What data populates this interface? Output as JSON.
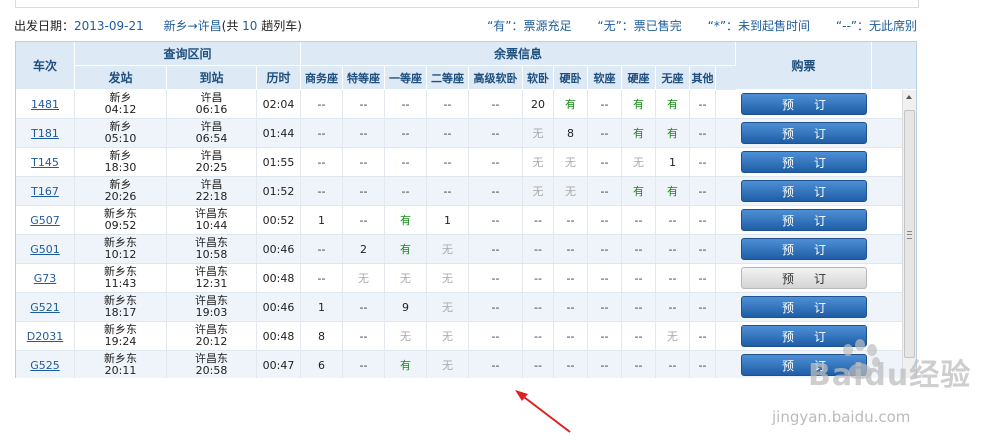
{
  "info": {
    "date_label": "出发日期：",
    "date": "2013-09-21",
    "route": "新乡→许昌",
    "count_prefix": "(共",
    "count": "10",
    "count_suffix": "趟列车)",
    "legend": [
      "“有”：票源充足",
      "“无”：票已售完",
      "“*”：未到起售时间",
      "“--”：无此席别"
    ]
  },
  "table": {
    "train_header": "车次",
    "range_header": "查询区间",
    "depart_header": "发站",
    "arrive_header": "到站",
    "duration_header": "历时",
    "ticket_header": "余票信息",
    "buy_header": "购票",
    "seat_headers": [
      "商务座",
      "特等座",
      "一等座",
      "二等座",
      "高级软卧",
      "软卧",
      "硬卧",
      "软座",
      "硬座",
      "无座",
      "其他"
    ],
    "book_label": "预订"
  },
  "rows": [
    {
      "train": "1481",
      "from": "新乡",
      "from_time": "04:12",
      "to": "许昌",
      "to_time": "06:16",
      "duration": "02:04",
      "seats": [
        "--",
        "--",
        "--",
        "--",
        "--",
        "20",
        "有",
        "--",
        "有",
        "有",
        "--"
      ],
      "enabled": true
    },
    {
      "train": "T181",
      "from": "新乡",
      "from_time": "05:10",
      "to": "许昌",
      "to_time": "06:54",
      "duration": "01:44",
      "seats": [
        "--",
        "--",
        "--",
        "--",
        "--",
        "无",
        "8",
        "--",
        "有",
        "有",
        "--"
      ],
      "enabled": true
    },
    {
      "train": "T145",
      "from": "新乡",
      "from_time": "18:30",
      "to": "许昌",
      "to_time": "20:25",
      "duration": "01:55",
      "seats": [
        "--",
        "--",
        "--",
        "--",
        "--",
        "无",
        "无",
        "--",
        "无",
        "1",
        "--"
      ],
      "enabled": true
    },
    {
      "train": "T167",
      "from": "新乡",
      "from_time": "20:26",
      "to": "许昌",
      "to_time": "22:18",
      "duration": "01:52",
      "seats": [
        "--",
        "--",
        "--",
        "--",
        "--",
        "无",
        "无",
        "--",
        "有",
        "有",
        "--"
      ],
      "enabled": true
    },
    {
      "train": "G507",
      "from": "新乡东",
      "from_time": "09:52",
      "to": "许昌东",
      "to_time": "10:44",
      "duration": "00:52",
      "seats": [
        "1",
        "--",
        "有",
        "1",
        "--",
        "--",
        "--",
        "--",
        "--",
        "--",
        "--"
      ],
      "enabled": true
    },
    {
      "train": "G501",
      "from": "新乡东",
      "from_time": "10:12",
      "to": "许昌东",
      "to_time": "10:58",
      "duration": "00:46",
      "seats": [
        "--",
        "2",
        "有",
        "无",
        "--",
        "--",
        "--",
        "--",
        "--",
        "--",
        "--"
      ],
      "enabled": true
    },
    {
      "train": "G73",
      "from": "新乡东",
      "from_time": "11:43",
      "to": "许昌东",
      "to_time": "12:31",
      "duration": "00:48",
      "seats": [
        "--",
        "无",
        "无",
        "无",
        "--",
        "--",
        "--",
        "--",
        "--",
        "--",
        "--"
      ],
      "enabled": false
    },
    {
      "train": "G521",
      "from": "新乡东",
      "from_time": "18:17",
      "to": "许昌东",
      "to_time": "19:03",
      "duration": "00:46",
      "seats": [
        "1",
        "--",
        "9",
        "无",
        "--",
        "--",
        "--",
        "--",
        "--",
        "--",
        "--"
      ],
      "enabled": true
    },
    {
      "train": "D2031",
      "from": "新乡东",
      "from_time": "19:24",
      "to": "许昌东",
      "to_time": "20:12",
      "duration": "00:48",
      "seats": [
        "8",
        "--",
        "无",
        "无",
        "--",
        "--",
        "--",
        "--",
        "--",
        "无",
        "--"
      ],
      "enabled": true
    },
    {
      "train": "G525",
      "from": "新乡东",
      "from_time": "20:11",
      "to": "许昌东",
      "to_time": "20:58",
      "duration": "00:47",
      "seats": [
        "6",
        "--",
        "有",
        "无",
        "--",
        "--",
        "--",
        "--",
        "--",
        "--",
        "--"
      ],
      "enabled": true
    }
  ],
  "colors": {
    "accent": "#1f5c9b",
    "available": "#178a17",
    "soldout": "#aaaaaa",
    "header_bg": "#dde9f4",
    "row_alt": "#eef4f9",
    "annotation": "#e02020"
  },
  "watermark": {
    "brand": "Baidu经验",
    "url": "jingyan.baidu.com"
  }
}
